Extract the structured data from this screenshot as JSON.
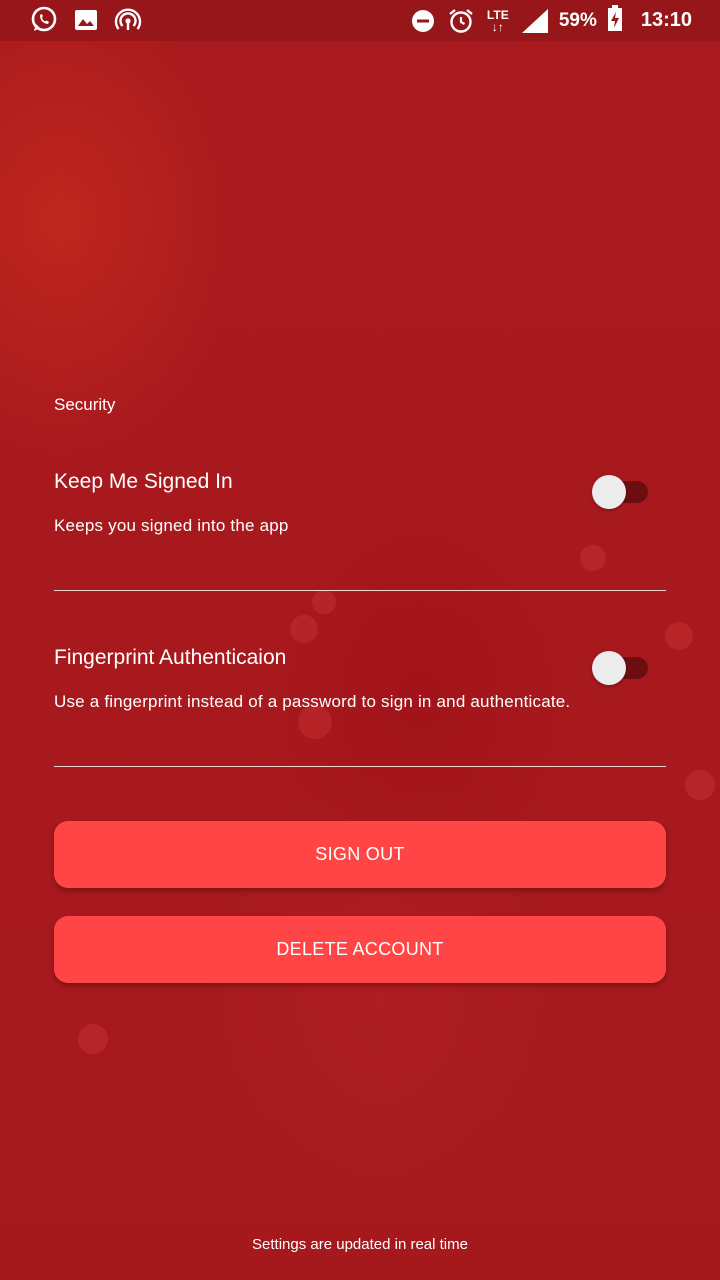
{
  "status_bar": {
    "icons_left": [
      "whatsapp-icon",
      "gallery-icon",
      "hotspot-icon"
    ],
    "icons_right": [
      "do-not-disturb-icon",
      "alarm-icon",
      "lte-icon",
      "signal-icon",
      "battery-charging-icon"
    ],
    "network_label": "LTE",
    "battery": "59%",
    "time": "13:10"
  },
  "security": {
    "section_title": "Security",
    "keep_signed_in": {
      "title": "Keep Me Signed In",
      "description": "Keeps you signed into the app",
      "enabled": false
    },
    "fingerprint": {
      "title": "Fingerprint Authenticaion",
      "description": "Use a fingerprint instead of a password to sign in and authenticate.",
      "enabled": false
    }
  },
  "actions": {
    "sign_out_label": "SIGN OUT",
    "delete_account_label": "DELETE ACCOUNT"
  },
  "footer": {
    "text": "Settings are updated in real time"
  },
  "colors": {
    "background": "#a8191e",
    "status_bar": "#96161a",
    "button": "#ff4545",
    "toggle_track_off": "#6e0d10",
    "toggle_thumb": "#ececec"
  }
}
